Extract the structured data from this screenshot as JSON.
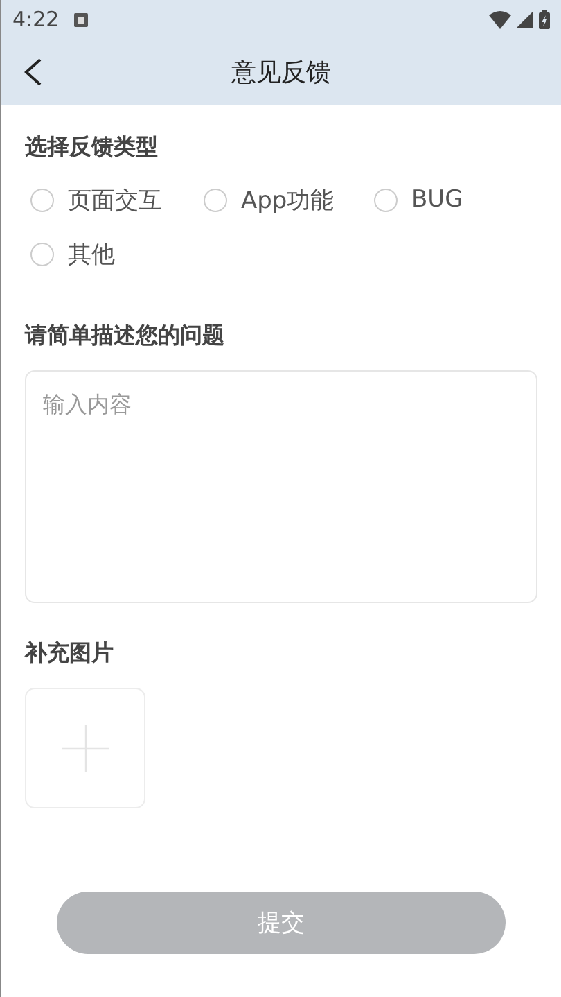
{
  "status_bar": {
    "time": "4:22"
  },
  "header": {
    "title": "意见反馈"
  },
  "feedback_type": {
    "heading": "选择反馈类型",
    "options": [
      {
        "label": "页面交互",
        "selected": false
      },
      {
        "label": "App功能",
        "selected": false
      },
      {
        "label": "BUG",
        "selected": false
      },
      {
        "label": "其他",
        "selected": false
      }
    ]
  },
  "description": {
    "heading": "请简单描述您的问题",
    "placeholder": "输入内容"
  },
  "images": {
    "heading": "补充图片"
  },
  "submit": {
    "label": "提交",
    "disabled": true
  }
}
